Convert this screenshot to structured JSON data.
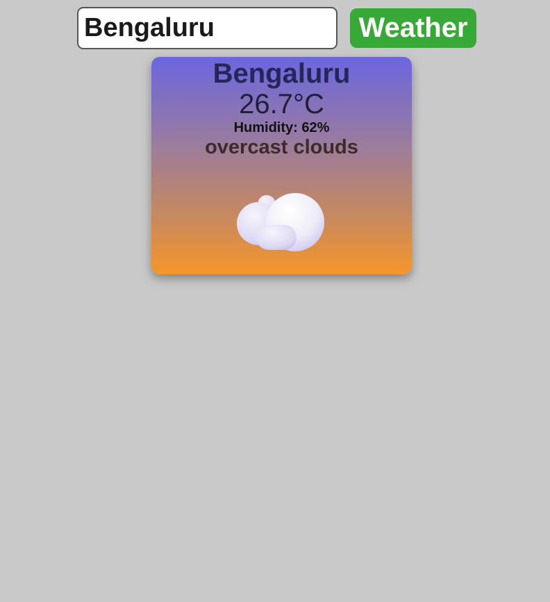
{
  "search": {
    "value": "Bengaluru",
    "button_label": "Weather"
  },
  "card": {
    "city": "Bengaluru",
    "temperature": "26.7°C",
    "humidity": "Humidity: 62%",
    "description": "overcast clouds",
    "icon": "cloud-icon"
  },
  "colors": {
    "background": "#c9c9c9",
    "button": "#36a936",
    "card_gradient_top": "#6b66e0",
    "card_gradient_bottom": "#f6962a"
  }
}
